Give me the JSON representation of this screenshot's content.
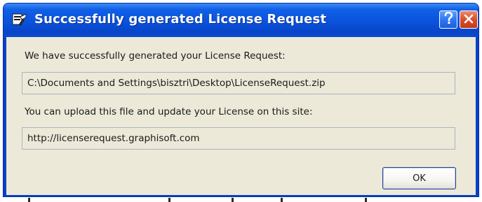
{
  "window": {
    "title": "Successfully generated License Request",
    "help_glyph": "?",
    "close_glyph": "✕"
  },
  "dialog": {
    "message_1": "We have successfully generated your License Request:",
    "file_path": "C:\\Documents and Settings\\bisztri\\Desktop\\LicenseRequest.zip",
    "message_2": "You can upload this file and update your License on this site:",
    "url": "http://licenserequest.graphisoft.com",
    "ok_label": "OK"
  },
  "icons": {
    "app": "app-icon",
    "help": "help-icon",
    "close": "close-icon"
  },
  "colors": {
    "titlebar": "#0a52dc",
    "client": "#ece9d8",
    "close_button": "#dc4e2a",
    "help_button": "#2f78f0"
  }
}
